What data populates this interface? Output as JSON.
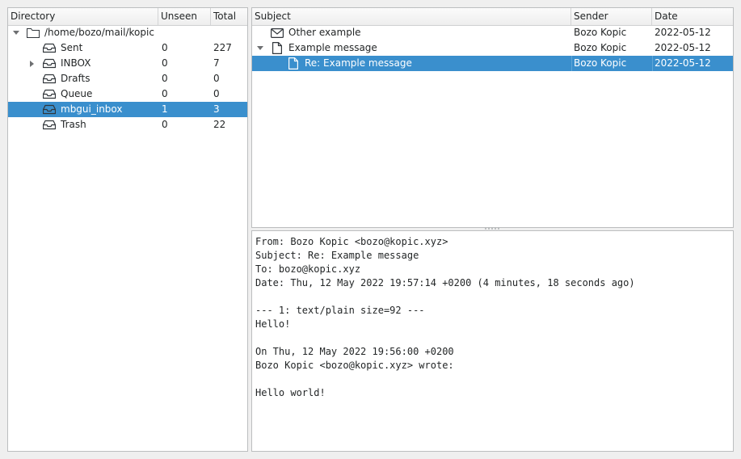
{
  "directory": {
    "headers": {
      "name": "Directory",
      "unseen": "Unseen",
      "total": "Total"
    },
    "root": {
      "path": "/home/bozo/mail/kopic",
      "icon": "folder-icon",
      "expanded": true
    },
    "items": [
      {
        "name": "Sent",
        "unseen": "0",
        "total": "227",
        "icon": "inbox-tray-icon",
        "expandable": false,
        "selected": false
      },
      {
        "name": "INBOX",
        "unseen": "0",
        "total": "7",
        "icon": "inbox-tray-icon",
        "expandable": true,
        "selected": false
      },
      {
        "name": "Drafts",
        "unseen": "0",
        "total": "0",
        "icon": "inbox-tray-icon",
        "expandable": false,
        "selected": false
      },
      {
        "name": "Queue",
        "unseen": "0",
        "total": "0",
        "icon": "inbox-tray-icon",
        "expandable": false,
        "selected": false
      },
      {
        "name": "mbgui_inbox",
        "unseen": "1",
        "total": "3",
        "icon": "inbox-tray-icon",
        "expandable": false,
        "selected": true
      },
      {
        "name": "Trash",
        "unseen": "0",
        "total": "22",
        "icon": "inbox-tray-icon",
        "expandable": false,
        "selected": false
      }
    ]
  },
  "messages": {
    "headers": {
      "subject": "Subject",
      "sender": "Sender",
      "date": "Date"
    },
    "rows": [
      {
        "subject": "Other example",
        "sender": "Bozo Kopic",
        "date": "2022-05-12",
        "icon": "envelope-icon",
        "selected": false
      },
      {
        "subject": "Example message",
        "sender": "Bozo Kopic",
        "date": "2022-05-12",
        "icon": "document-icon",
        "selected": false,
        "expanded": true
      },
      {
        "subject": "Re: Example message",
        "sender": "Bozo Kopic",
        "date": "2022-05-12",
        "icon": "document-icon",
        "selected": true
      }
    ]
  },
  "message_body": {
    "lines": [
      "From: Bozo Kopic <bozo@kopic.xyz>",
      "Subject: Re: Example message",
      "To: bozo@kopic.xyz",
      "Date: Thu, 12 May 2022 19:57:14 +0200 (4 minutes, 18 seconds ago)",
      "",
      "--- 1: text/plain size=92 ---",
      "Hello!",
      "",
      "On Thu, 12 May 2022 19:56:00 +0200",
      "Bozo Kopic <bozo@kopic.xyz> wrote:",
      "",
      "Hello world!"
    ]
  },
  "colors": {
    "selection": "#3a8fcd",
    "background": "#efefef",
    "text": "#232627"
  }
}
